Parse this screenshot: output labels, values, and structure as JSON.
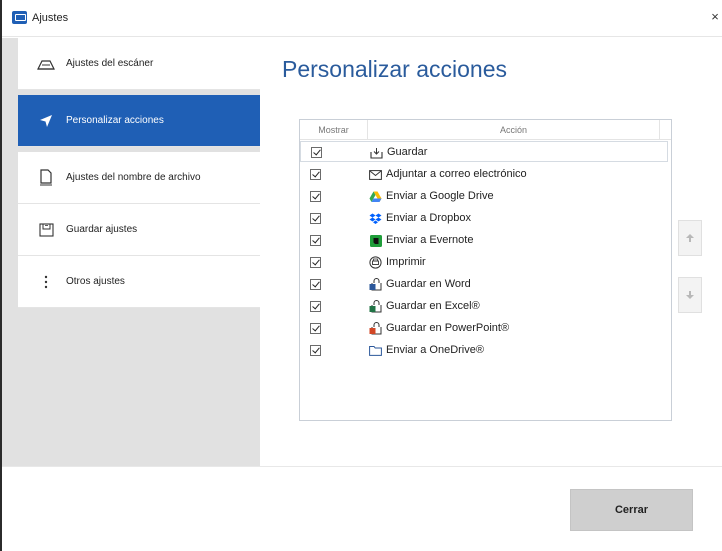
{
  "window": {
    "title": "Ajustes",
    "close_glyph": "×"
  },
  "sidebar": {
    "items": [
      {
        "label": "Ajustes del escáner",
        "icon": "scanner-icon",
        "active": false
      },
      {
        "label": "Personalizar acciones",
        "icon": "send-icon",
        "active": true
      },
      {
        "label": "Ajustes del nombre de archivo",
        "icon": "document-icon",
        "active": false
      },
      {
        "label": "Guardar ajustes",
        "icon": "save-settings-icon",
        "active": false
      },
      {
        "label": "Otros ajustes",
        "icon": "more-vertical-icon",
        "active": false
      }
    ]
  },
  "main": {
    "title": "Personalizar acciones",
    "columns": {
      "show": "Mostrar",
      "action": "Acción"
    },
    "actions": [
      {
        "label": "Guardar",
        "checked": true,
        "icon": "save-icon"
      },
      {
        "label": "Adjuntar a correo electrónico",
        "checked": true,
        "icon": "email-icon"
      },
      {
        "label": "Enviar a Google Drive",
        "checked": true,
        "icon": "google-drive-icon"
      },
      {
        "label": "Enviar a Dropbox",
        "checked": true,
        "icon": "dropbox-icon"
      },
      {
        "label": "Enviar a Evernote",
        "checked": true,
        "icon": "evernote-icon"
      },
      {
        "label": "Imprimir",
        "checked": true,
        "icon": "print-icon"
      },
      {
        "label": "Guardar en Word",
        "checked": true,
        "icon": "word-icon"
      },
      {
        "label": "Guardar en Excel®",
        "checked": true,
        "icon": "excel-icon"
      },
      {
        "label": "Guardar en PowerPoint®",
        "checked": true,
        "icon": "powerpoint-icon"
      },
      {
        "label": "Enviar a OneDrive®",
        "checked": true,
        "icon": "onedrive-folder-icon"
      }
    ]
  },
  "footer": {
    "close_label": "Cerrar"
  },
  "colors": {
    "accent": "#1f5fb5",
    "title": "#2a5b9c",
    "sidebar_bg": "#e1e1e1",
    "close_button_bg": "#cfcfcf"
  }
}
